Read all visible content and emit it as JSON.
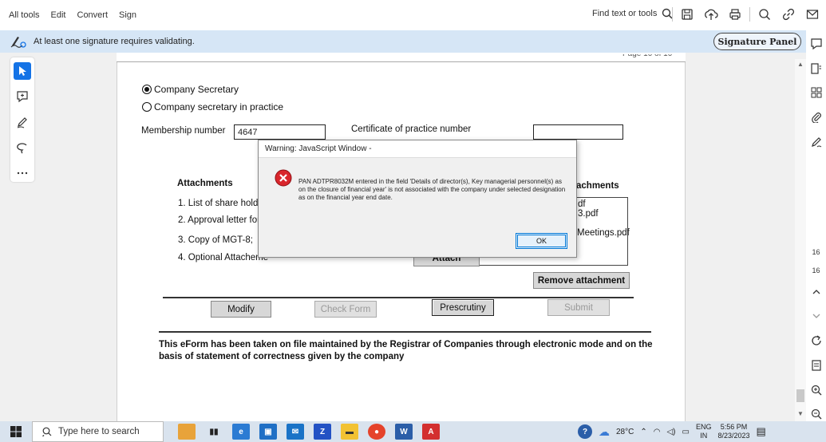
{
  "menu": [
    "All tools",
    "Edit",
    "Convert",
    "Sign"
  ],
  "find_tools": "Find text or tools",
  "signature_banner": {
    "message": "At least one signature requires validating.",
    "button": "Signature Panel"
  },
  "page_indicator": "Page 10 of 10",
  "form": {
    "radio_company_secretary": "Company Secretary",
    "radio_company_secretary_practice": "Company secretary in practice",
    "membership_label": "Membership number",
    "membership_value": "4647",
    "certificate_label": "Certificate of practice number",
    "certificate_value": "",
    "attachments_heading": "Attachments",
    "attachments_list_heading": "achments",
    "attachment_items": [
      "1. List of share holders",
      "2. Approval letter for ex",
      "3. Copy of MGT-8;",
      "4. Optional Attacheme"
    ],
    "attached_files": [
      "df",
      "3.pdf",
      "Meetings.pdf"
    ],
    "attach_button": "Attach",
    "remove_attachment_button": "Remove attachment",
    "buttons": {
      "modify": "Modify",
      "check_form": "Check Form",
      "prescrutiny": "Prescrutiny",
      "submit": "Submit"
    },
    "footer_text": "This eForm has been taken on file maintained by the Registrar of Companies through electronic mode and on the basis of statement of correctness given by the company"
  },
  "dialog": {
    "title": "Warning: JavaScript Window -",
    "message": "PAN ADTPR8032M entered in the field 'Details of director(s), Key managerial personnel(s) as on the closure of financial year' is not associated with the company under selected designation as on the financial year end date.",
    "ok": "OK"
  },
  "right_sidebar": {
    "page_numbers": [
      "16",
      "16"
    ]
  },
  "taskbar": {
    "search_placeholder": "Type here to search",
    "weather": "28°C",
    "language": "ENG",
    "region": "IN",
    "time": "5:56 PM",
    "date": "8/23/2023"
  },
  "colors": {
    "banner_bg": "#d6e6f6",
    "accent": "#1473e6",
    "error_icon": "#d9262c",
    "taskbar_bg": "#d9e3ee"
  }
}
